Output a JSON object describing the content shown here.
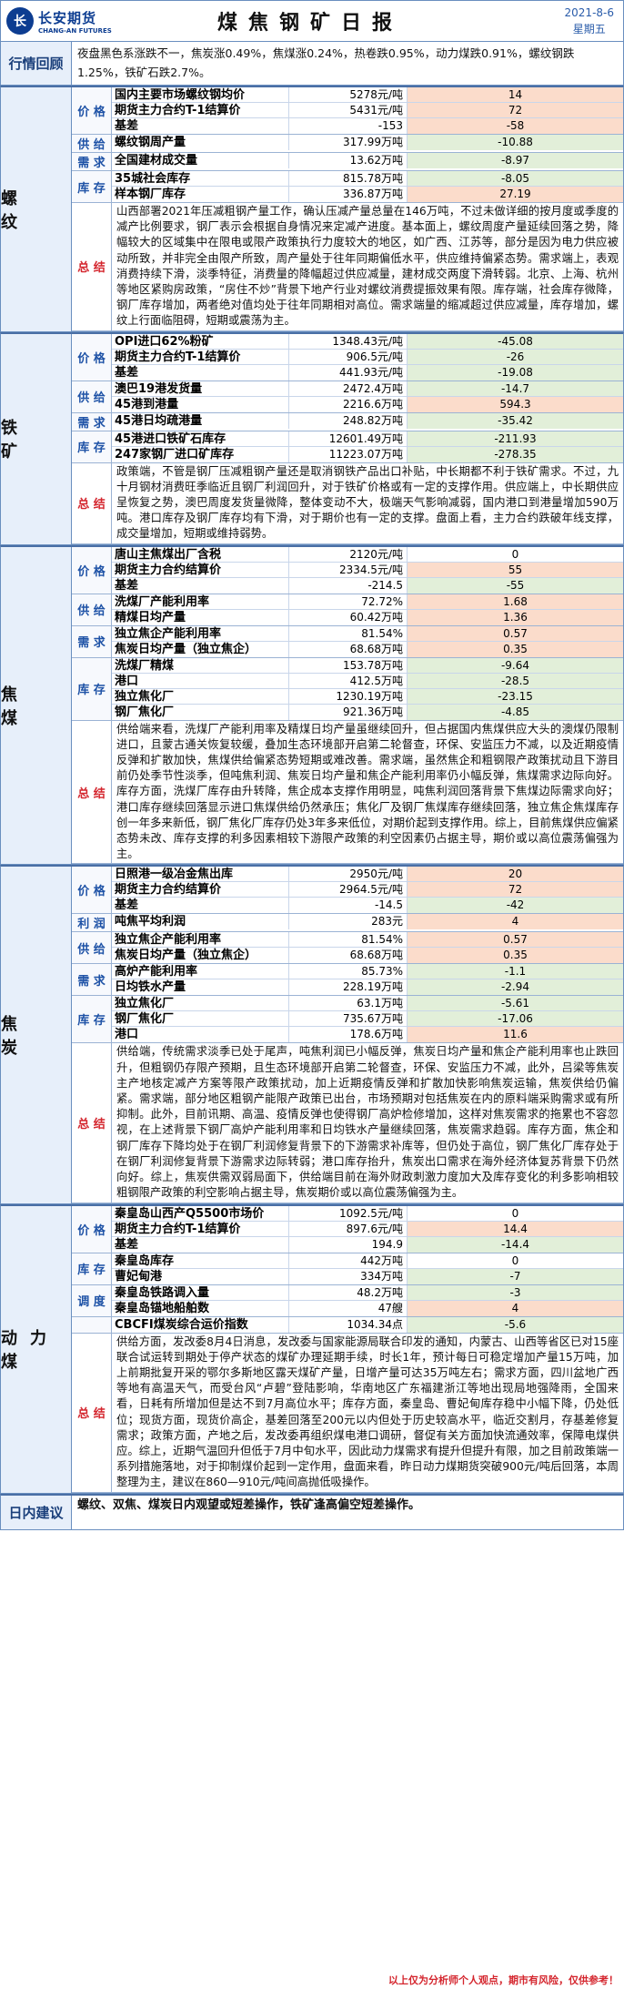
{
  "header": {
    "logo_cn": "长安期货",
    "logo_en": "CHANG-AN FUTURES",
    "title": "煤焦钢矿日报",
    "date": "2021-8-6",
    "weekday": "星期五"
  },
  "recap": {
    "label": "行情回顾",
    "text": "夜盘黑色系涨跌不一，焦炭涨0.49%，焦煤涨0.24%，热卷跌0.95%，动力煤跌0.91%，螺纹钢跌1.25%，铁矿石跌2.7%。"
  },
  "sections": [
    {
      "name": "螺 纹",
      "groups": [
        {
          "cat": "价 格",
          "rows": [
            {
              "label": "国内主要市场螺纹钢均价",
              "value": "5278元/吨",
              "change": "14",
              "tone": "pos"
            },
            {
              "label": "期货主力合约T-1结算价",
              "value": "5431元/吨",
              "change": "72",
              "tone": "pos"
            },
            {
              "label": "基差",
              "value": "-153",
              "change": "-58",
              "tone": "pos"
            }
          ]
        },
        {
          "cat": "供 给",
          "rows": [
            {
              "label": "螺纹钢周产量",
              "value": "317.99万吨",
              "change": "-10.88",
              "tone": "neg"
            }
          ]
        },
        {
          "cat": "需 求",
          "rows": [
            {
              "label": "全国建材成交量",
              "value": "13.62万吨",
              "change": "-8.97",
              "tone": "neg"
            }
          ]
        },
        {
          "cat": "库 存",
          "rows": [
            {
              "label": "35城社会库存",
              "value": "815.78万吨",
              "change": "-8.05",
              "tone": "neg"
            },
            {
              "label": "样本钢厂库存",
              "value": "336.87万吨",
              "change": "27.19",
              "tone": "pos"
            }
          ]
        }
      ],
      "summary": "山西部署2021年压减粗钢产量工作，确认压减产量总量在146万吨，不过未做详细的按月度或季度的减产比例要求，钢厂表示会根据自身情况来定减产进度。基本面上，螺纹周度产量延续回落之势，降幅较大的区域集中在限电或限产政策执行力度较大的地区，如广西、江苏等，部分是因为电力供应被动所致，并非完全由限产所致，周产量处于往年同期偏低水平，供应维持偏紧态势。需求端上，表观消费持续下滑，淡季特征，消费量的降幅超过供应减量，建材成交两度下滑转弱。北京、上海、杭州等地区紧购房政策，“房住不炒”背景下地产行业对螺纹消费提振效果有限。库存端，社会库存微降，钢厂库存增加，两者绝对值均处于往年同期相对高位。需求端量的缩减超过供应减量，库存增加，螺纹上行面临阻碍，短期或震荡为主。"
    },
    {
      "name": "铁 矿",
      "groups": [
        {
          "cat": "价 格",
          "rows": [
            {
              "label": "OPI进口62%粉矿",
              "value": "1348.43元/吨",
              "change": "-45.08",
              "tone": "neg"
            },
            {
              "label": "期货主力合约T-1结算价",
              "value": "906.5元/吨",
              "change": "-26",
              "tone": "neg"
            },
            {
              "label": "基差",
              "value": "441.93元/吨",
              "change": "-19.08",
              "tone": "neg"
            }
          ]
        },
        {
          "cat": "供 给",
          "rows": [
            {
              "label": "澳巴19港发货量",
              "value": "2472.4万吨",
              "change": "-14.7",
              "tone": "neg"
            },
            {
              "label": "45港到港量",
              "value": "2216.6万吨",
              "change": "594.3",
              "tone": "pos"
            }
          ]
        },
        {
          "cat": "需 求",
          "rows": [
            {
              "label": "45港日均疏港量",
              "value": "248.82万吨",
              "change": "-35.42",
              "tone": "neg"
            }
          ]
        },
        {
          "cat": "库 存",
          "rows": [
            {
              "label": "45港进口铁矿石库存",
              "value": "12601.49万吨",
              "change": "-211.93",
              "tone": "neg"
            },
            {
              "label": "247家钢厂进口矿库存",
              "value": "11223.07万吨",
              "change": "-278.35",
              "tone": "neg"
            }
          ]
        }
      ],
      "summary": "政策端，不管是钢厂压减粗钢产量还是取消钢铁产品出口补贴，中长期都不利于铁矿需求。不过，九十月钢材消费旺季临近且钢厂利润回升，对于铁矿价格或有一定的支撑作用。供应端上，中长期供应呈恢复之势，澳巴周度发货量微降，整体变动不大，极端天气影响减弱，国内港口到港量增加590万吨。港口库存及钢厂库存均有下滑，对于期价也有一定的支撑。盘面上看，主力合约跌破年线支撑，成交量增加，短期或维持弱势。"
    },
    {
      "name": "焦 煤",
      "groups": [
        {
          "cat": "价 格",
          "rows": [
            {
              "label": "唐山主焦煤出厂含税",
              "value": "2120元/吨",
              "change": "0",
              "tone": ""
            },
            {
              "label": "期货主力合约结算价",
              "value": "2334.5元/吨",
              "change": "55",
              "tone": "pos"
            },
            {
              "label": "基差",
              "value": "-214.5",
              "change": "-55",
              "tone": "neg"
            }
          ]
        },
        {
          "cat": "供 给",
          "rows": [
            {
              "label": "洗煤厂产能利用率",
              "value": "72.72%",
              "change": "1.68",
              "tone": "pos"
            },
            {
              "label": "精煤日均产量",
              "value": "60.42万吨",
              "change": "1.36",
              "tone": "pos"
            }
          ]
        },
        {
          "cat": "需 求",
          "rows": [
            {
              "label": "独立焦企产能利用率",
              "value": "81.54%",
              "change": "0.57",
              "tone": "pos"
            },
            {
              "label": "焦炭日均产量（独立焦企）",
              "value": "68.68万吨",
              "change": "0.35",
              "tone": "pos"
            }
          ]
        },
        {
          "cat": "库 存",
          "rows": [
            {
              "label": "洗煤厂精煤",
              "value": "153.78万吨",
              "change": "-9.64",
              "tone": "neg"
            },
            {
              "label": "港口",
              "value": "412.5万吨",
              "change": "-28.5",
              "tone": "neg"
            },
            {
              "label": "独立焦化厂",
              "value": "1230.19万吨",
              "change": "-23.15",
              "tone": "neg"
            },
            {
              "label": "钢厂焦化厂",
              "value": "921.36万吨",
              "change": "-4.85",
              "tone": "neg"
            }
          ]
        }
      ],
      "summary": "供给端来看，洗煤厂产能利用率及精煤日均产量虽继续回升，但占据国内焦煤供应大头的澳煤仍限制进口，且蒙古通关恢复较缓，叠加生态环境部开启第二轮督查，环保、安监压力不减，以及近期疫情反弹和扩散加快，焦煤供给偏紧态势短期或难改善。需求端，虽然焦企和粗钢限产政策扰动且下游目前仍处季节性淡季，但吨焦利润、焦炭日均产量和焦企产能利用率仍小幅反弹，焦煤需求边际向好。库存方面，洗煤厂库存由升转降，焦企成本支撑作用明显，吨焦利润回落背景下焦煤边际需求向好；港口库存继续回落显示进口焦煤供给仍然承压；焦化厂及钢厂焦煤库存继续回落，独立焦企焦煤库存创一年多来新低，钢厂焦化厂库存仍处3年多来低位，对期价起到支撑作用。综上，目前焦煤供应偏紧态势未改、库存支撑的利多因素相较下游限产政策的利空因素仍占据主导，期价或以高位震荡偏强为主。"
    },
    {
      "name": "焦 炭",
      "groups": [
        {
          "cat": "价 格",
          "rows": [
            {
              "label": "日照港一级冶金焦出库",
              "value": "2950元/吨",
              "change": "20",
              "tone": "pos"
            },
            {
              "label": "期货主力合约结算价",
              "value": "2964.5元/吨",
              "change": "72",
              "tone": "pos"
            },
            {
              "label": "基差",
              "value": "-14.5",
              "change": "-42",
              "tone": "neg"
            }
          ]
        },
        {
          "cat": "利 润",
          "rows": [
            {
              "label": "吨焦平均利润",
              "value": "283元",
              "change": "4",
              "tone": "pos"
            }
          ]
        },
        {
          "cat": "供 给",
          "rows": [
            {
              "label": "独立焦企产能利用率",
              "value": "81.54%",
              "change": "0.57",
              "tone": "pos"
            },
            {
              "label": "焦炭日均产量（独立焦企）",
              "value": "68.68万吨",
              "change": "0.35",
              "tone": "pos"
            }
          ]
        },
        {
          "cat": "需 求",
          "rows": [
            {
              "label": "高炉产能利用率",
              "value": "85.73%",
              "change": "-1.1",
              "tone": "neg"
            },
            {
              "label": "日均铁水产量",
              "value": "228.19万吨",
              "change": "-2.94",
              "tone": "neg"
            }
          ]
        },
        {
          "cat": "库 存",
          "rows": [
            {
              "label": "独立焦化厂",
              "value": "63.1万吨",
              "change": "-5.61",
              "tone": "neg"
            },
            {
              "label": "钢厂焦化厂",
              "value": "735.67万吨",
              "change": "-17.06",
              "tone": "neg"
            },
            {
              "label": "港口",
              "value": "178.6万吨",
              "change": "11.6",
              "tone": "pos"
            }
          ]
        }
      ],
      "summary": "供给端，传统需求淡季已处于尾声，吨焦利润已小幅反弹，焦炭日均产量和焦企产能利用率也止跌回升，但粗钢仍存限产预期，且生态环境部开启第二轮督查，环保、安监压力不减，此外，吕梁等焦炭主产地核定减产方案等限产政策扰动，加上近期疫情反弹和扩散加快影响焦炭运输，焦炭供给仍偏紧。需求端，部分地区粗钢产能限产政策已出台，市场预期对包括焦炭在内的原料端采购需求或有所抑制。此外，目前讯期、高温、疫情反弹也使得钢厂高炉检修增加，这样对焦炭需求的拖累也不容忽视，在上述背景下钢厂高炉产能利用率和日均铁水产量继续回落，焦炭需求趋弱。库存方面，焦企和钢厂库存下降均处于在钢厂利润修复背景下的下游需求补库等，但仍处于高位，钢厂焦化厂库存处于在钢厂利润修复背景下游需求边际转弱；港口库存抬升，焦炭出口需求在海外经济体复苏背景下仍然向好。综上，焦炭供需双弱局面下，供给端目前在海外财政刺激力度加大及库存变化的利多影响相较粗钢限产政策的利空影响占据主导，焦炭期价或以高位震荡偏强为主。"
    },
    {
      "name": "动力煤",
      "groups": [
        {
          "cat": "价 格",
          "rows": [
            {
              "label": "秦皇岛山西产Q5500市场价",
              "value": "1092.5元/吨",
              "change": "0",
              "tone": ""
            },
            {
              "label": "期货主力合约T-1结算价",
              "value": "897.6元/吨",
              "change": "14.4",
              "tone": "pos"
            },
            {
              "label": "基差",
              "value": "194.9",
              "change": "-14.4",
              "tone": "neg"
            }
          ]
        },
        {
          "cat": "库 存",
          "rows": [
            {
              "label": "秦皇岛库存",
              "value": "442万吨",
              "change": "0",
              "tone": ""
            },
            {
              "label": "曹妃甸港",
              "value": "334万吨",
              "change": "-7",
              "tone": "neg"
            }
          ]
        },
        {
          "cat": "调 度",
          "rows": [
            {
              "label": "秦皇岛铁路调入量",
              "value": "48.2万吨",
              "change": "-3",
              "tone": "neg"
            },
            {
              "label": "秦皇岛锚地船舶数",
              "value": "47艘",
              "change": "4",
              "tone": "pos"
            }
          ]
        },
        {
          "cat": "",
          "rows": [
            {
              "label": "CBCFI煤炭综合运价指数",
              "value": "1034.34点",
              "change": "-5.6",
              "tone": "neg"
            }
          ]
        }
      ],
      "summary": "供给方面，发改委8月4日消息，发改委与国家能源局联合印发的通知，内蒙古、山西等省区已对15座联合试运转到期处于停产状态的煤矿办理延期手续，时长1年，预计每日可稳定增加产量15万吨，加上前期批复开采的鄂尔多斯地区露天煤矿产量，日增产量可达35万吨左右；需求方面，四川盆地广西等地有高温天气，而受台风“卢碧”登陆影响，华南地区广东福建浙江等地出现局地强降雨，全国来看，日耗有所增加但是达不到7月高位水平；库存方面，秦皇岛、曹妃甸库存稳中小幅下降，仍处低位；现货方面，现货价高企，基差回落至200元以内但处于历史较高水平，临近交割月，存基差修复需求；政策方面，产地之后，发改委再组织煤电港口调研，督促有关方面加快流通效率，保障电煤供应。综上，近期气温回升但低于7月中旬水平，因此动力煤需求有提升但提升有限，加之目前政策端一系列措施落地，对于抑制煤价起到一定作用，盘面来看，昨日动力煤期货突破900元/吨后回落，本周整理为主，建议在860—910元/吨间高抛低吸操作。"
    }
  ],
  "advice": {
    "label": "日内建议",
    "text": "螺纹、双焦、煤炭日内观望或短差操作，铁矿逢高偏空短差操作。"
  },
  "disclaimer": "以上仅为分析师个人观点，期市有风险，仅供参考！"
}
